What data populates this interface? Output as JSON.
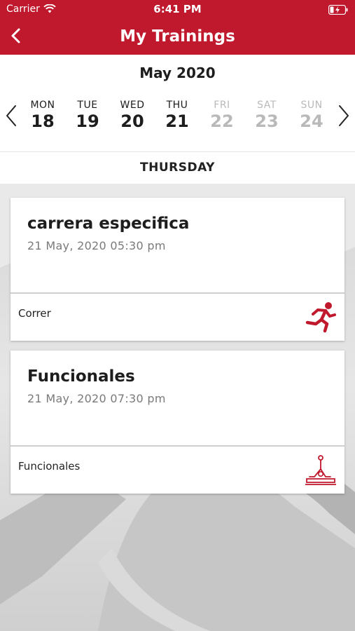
{
  "status_bar": {
    "carrier": "Carrier",
    "time": "6:41 PM"
  },
  "nav": {
    "title": "My Trainings",
    "back_icon": "chevron-left-icon"
  },
  "calendar": {
    "month": "May 2020",
    "days": [
      {
        "name": "MON",
        "num": "18",
        "enabled": true
      },
      {
        "name": "TUE",
        "num": "19",
        "enabled": true
      },
      {
        "name": "WED",
        "num": "20",
        "enabled": true
      },
      {
        "name": "THU",
        "num": "21",
        "enabled": true
      },
      {
        "name": "FRI",
        "num": "22",
        "enabled": false
      },
      {
        "name": "SAT",
        "num": "23",
        "enabled": false
      },
      {
        "name": "SUN",
        "num": "24",
        "enabled": false
      }
    ],
    "selected_weekday": "THURSDAY"
  },
  "trainings": [
    {
      "title": "carrera especifica",
      "datetime": "21 May, 2020 05:30 pm",
      "type": "Correr",
      "icon": "running-icon"
    },
    {
      "title": "Funcionales",
      "datetime": "21 May, 2020 07:30 pm",
      "type": "Funcionales",
      "icon": "kettlebell-exercise-icon"
    }
  ],
  "colors": {
    "brand": "#c0182c",
    "dim_day": "#b9b9b9"
  }
}
